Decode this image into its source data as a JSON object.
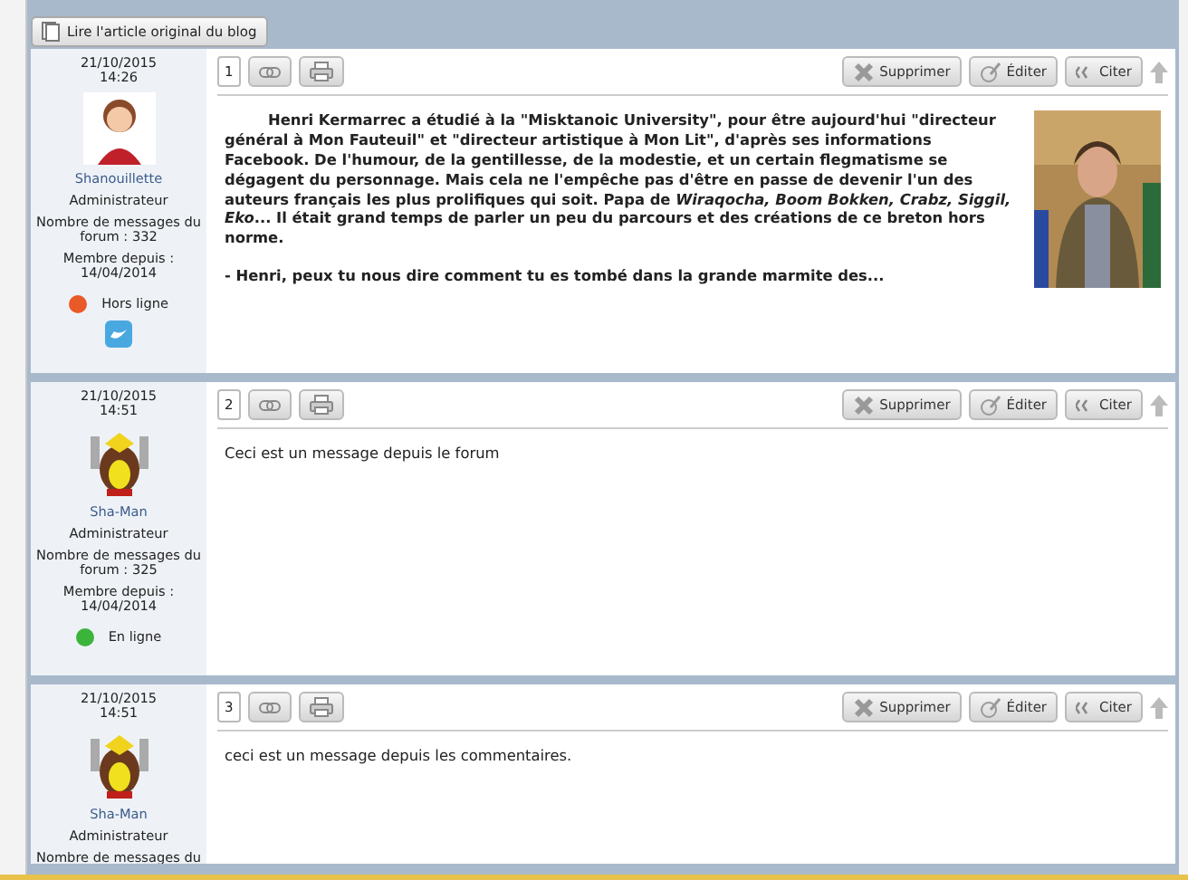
{
  "blog_link": {
    "label": "Lire l'article original du blog"
  },
  "posts": [
    {
      "number": "1",
      "date": "21/10/2015",
      "time": "14:26",
      "author": "Shanouillette",
      "role": "Administrateur",
      "message_count": "Nombre de messages du forum : 332",
      "member_since": "Membre depuis : 14/04/2014",
      "online": false,
      "status": "Hors ligne",
      "twitter": true,
      "buttons": [
        "Supprimer",
        "Éditer",
        "Citer"
      ],
      "bold_body": true,
      "photo": {
        "kind": "picture"
      },
      "paragraphs": [
        "Henri Kermarrec a étudié à la \"Misktanoic University\", pour être aujourd'hui \"directeur général à Mon Fauteuil\" et \"directeur artistique à Mon Lit\", d'après ses informations Facebook. De l'humour, de la gentillesse, de la modestie, et un certain flegmatisme se dégagent du personnage. Mais cela ne l'empêche pas d'être en passe de devenir l'un des auteurs français les plus prolifiques qui soit. Papa de *Wiraqocha, Boom Bokken, Crabz, Siggil, Eko*... Il était grand temps de parler un peu du parcours et des créations de ce breton hors norme.",
        "- Henri, peux tu nous dire comment tu es tombé dans la grande marmite des..."
      ]
    },
    {
      "number": "2",
      "date": "21/10/2015",
      "time": "14:51",
      "author": "Sha-Man",
      "role": "Administrateur",
      "message_count": "Nombre de messages du forum : 325",
      "member_since": "Membre depuis : 14/04/2014",
      "online": true,
      "status": "En ligne",
      "twitter": false,
      "buttons": [
        "Supprimer",
        "Éditer",
        "Citer"
      ],
      "bold_body": false,
      "paragraphs": [
        "Ceci est un message depuis le forum"
      ]
    },
    {
      "number": "3",
      "date": "21/10/2015",
      "time": "14:51",
      "author": "Sha-Man",
      "role": "Administrateur",
      "message_count": "Nombre de messages du",
      "twitter": false,
      "buttons": [
        "Supprimer",
        "Éditer",
        "Citer"
      ],
      "bold_body": false,
      "paragraphs": [
        "ceci est un message depuis les commentaires."
      ]
    }
  ]
}
